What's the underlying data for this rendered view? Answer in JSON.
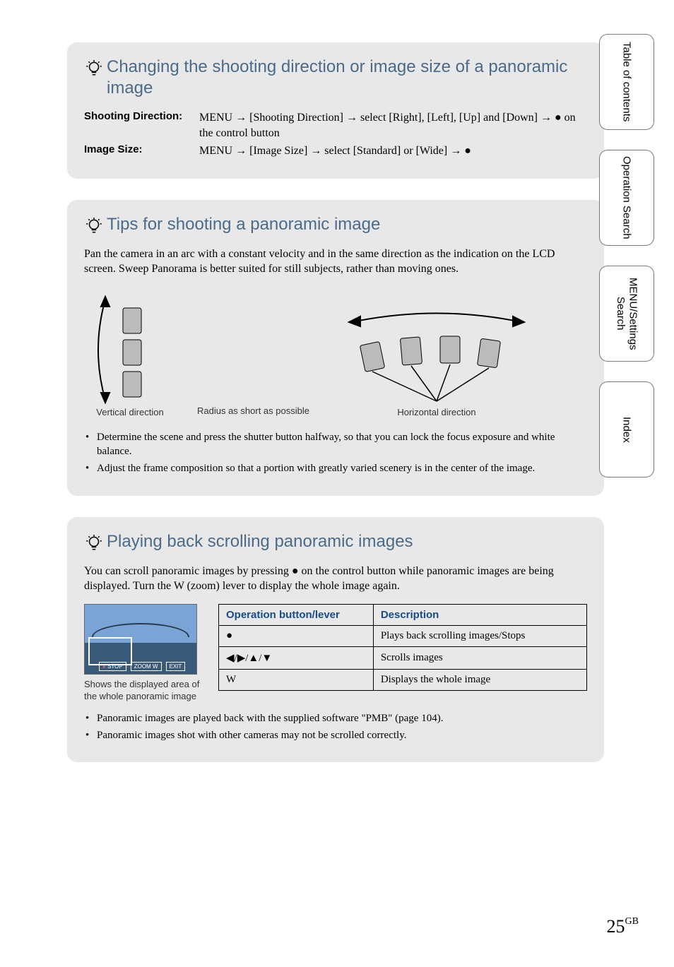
{
  "nav": {
    "tabs": [
      "Table of contents",
      "Operation Search",
      "MENU/Settings Search",
      "Index"
    ]
  },
  "section1": {
    "title": "Changing the shooting direction or image size of a panoramic image",
    "label_shooting": "Shooting Direction:",
    "text_shooting": "MENU → [Shooting Direction] → select [Right], [Left], [Up] and [Down] → ● on the control button",
    "label_image": "Image Size:",
    "text_image": "MENU → [Image Size] → select [Standard] or [Wide] → ●"
  },
  "section2": {
    "title": "Tips for shooting a panoramic image",
    "body": "Pan the camera in an arc with a constant velocity and in the same direction as the indication on the LCD screen. Sweep Panorama is better suited for still subjects, rather than moving ones.",
    "cap_vertical": "Vertical direction",
    "cap_radius": "Radius as short as possible",
    "cap_horizontal": "Horizontal direction",
    "bullets": [
      "Determine the scene and press the shutter button halfway, so that you can lock the focus exposure and white balance.",
      "Adjust the frame composition so that a portion with greatly varied scenery is in the center of the image."
    ]
  },
  "section3": {
    "title": "Playing back scrolling panoramic images",
    "body": "You can scroll panoramic images by pressing ● on the control button while panoramic images are being displayed. Turn the W (zoom) lever to display the whole image again.",
    "thumb_caption": "Shows the displayed area of the whole panoramic image",
    "thumb_stop": "STOP",
    "thumb_zoom": "ZOOM W",
    "thumb_exit": "EXIT",
    "th_op": "Operation button/lever",
    "th_desc": "Description",
    "rows": [
      {
        "op": "●",
        "desc": "Plays back scrolling images/Stops"
      },
      {
        "op": "◀/▶/▲/▼",
        "desc": "Scrolls images"
      },
      {
        "op": "W",
        "desc": "Displays the whole image"
      }
    ],
    "bullets": [
      "Panoramic images are played back with the supplied software \"PMB\" (page 104).",
      "Panoramic images shot with other cameras may not be scrolled correctly."
    ]
  },
  "page": {
    "number": "25",
    "suffix": "GB"
  }
}
